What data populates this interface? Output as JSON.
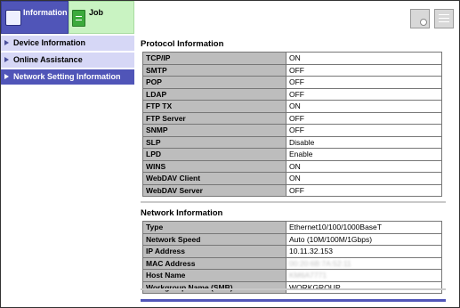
{
  "header": {
    "tabs": [
      {
        "label": "Information",
        "active": true,
        "icon": "information-icon"
      },
      {
        "label": "Job",
        "active": false,
        "icon": "job-icon"
      }
    ],
    "right_icons": [
      "device-status-icon",
      "menu-icon"
    ]
  },
  "sidebar": {
    "items": [
      {
        "label": "Device Information",
        "active": false
      },
      {
        "label": "Online Assistance",
        "active": false
      },
      {
        "label": "Network Setting Information",
        "active": true
      }
    ]
  },
  "protocol": {
    "title": "Protocol Information",
    "rows": [
      {
        "key": "TCP/IP",
        "value": "ON"
      },
      {
        "key": "SMTP",
        "value": "OFF"
      },
      {
        "key": "POP",
        "value": "OFF"
      },
      {
        "key": "LDAP",
        "value": "OFF"
      },
      {
        "key": "FTP TX",
        "value": "ON"
      },
      {
        "key": "FTP Server",
        "value": "OFF"
      },
      {
        "key": "SNMP",
        "value": "OFF"
      },
      {
        "key": "SLP",
        "value": "Disable"
      },
      {
        "key": "LPD",
        "value": "Enable"
      },
      {
        "key": "WINS",
        "value": "ON"
      },
      {
        "key": "WebDAV Client",
        "value": "ON"
      },
      {
        "key": "WebDAV Server",
        "value": "OFF"
      }
    ]
  },
  "network": {
    "title": "Network Information",
    "rows": [
      {
        "key": "Type",
        "value": "Ethernet10/100/1000BaseT"
      },
      {
        "key": "Network Speed",
        "value": "Auto (10M/100M/1Gbps)"
      },
      {
        "key": "IP Address",
        "value": "10.11.32.153"
      },
      {
        "key": "MAC Address",
        "value": "00:20:6B:7A:52:11",
        "obscured": true
      },
      {
        "key": "Host Name",
        "value": "KM6A7771",
        "obscured": true
      },
      {
        "key": "Workgroup Name (SMB)",
        "value": "WORKGROUP"
      }
    ]
  },
  "colors": {
    "accent": "#5055b8",
    "sidebar_bg": "#d6d7f6",
    "job_tab": "#c9f3c2",
    "key_cell": "#bdbdbd"
  }
}
